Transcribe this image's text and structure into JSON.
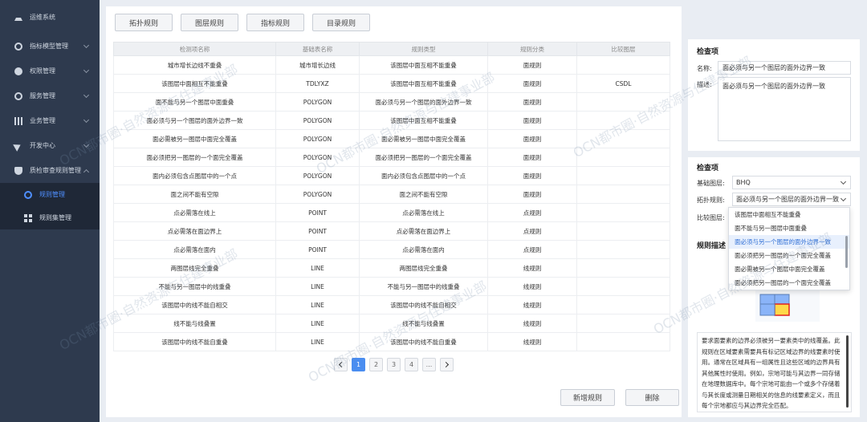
{
  "sidebar": {
    "brand": "运维系统",
    "items": [
      {
        "label": "指标模型管理"
      },
      {
        "label": "权限管理"
      },
      {
        "label": "服务管理"
      },
      {
        "label": "业务管理"
      },
      {
        "label": "开发中心"
      },
      {
        "label": "质检审查规则管理"
      }
    ],
    "subitems": [
      {
        "label": "规则管理"
      },
      {
        "label": "规则集管理"
      }
    ]
  },
  "toolbar": {
    "tabs": [
      {
        "label": "拓扑规则"
      },
      {
        "label": "图层规则"
      },
      {
        "label": "指标规则"
      },
      {
        "label": "目录规则"
      }
    ]
  },
  "table": {
    "headers": [
      "检测项名称",
      "基础表名称",
      "规则类型",
      "规则分类",
      "比较图层"
    ],
    "rows": [
      [
        "城市增长边线不重叠",
        "城市增长边线",
        "该图层中面互相不能重叠",
        "面规则",
        ""
      ],
      [
        "该图层中面相互不能重叠",
        "TDLYXZ",
        "该图层中面互相不能重叠",
        "面规则",
        "CSDL"
      ],
      [
        "面不能与另一个图层中面重叠",
        "POLYGON",
        "面必须与另一个图层的面外边界一致",
        "面规则",
        ""
      ],
      [
        "面必须与另一个图层的面外边界一致",
        "POLYGON",
        "该图层中面互相不能重叠",
        "面规则",
        ""
      ],
      [
        "面必需被另一图层中面完全覆盖",
        "POLYGON",
        "面必需被另一图层中面完全覆盖",
        "面规则",
        ""
      ],
      [
        "面必须把另一图层的一个面完全覆盖",
        "POLYGON",
        "面必须把另一图层的一个面完全覆盖",
        "面规则",
        ""
      ],
      [
        "面内必须包含点图层中的一个点",
        "POLYGON",
        "面内必须包含点图层中的一个点",
        "面规则",
        ""
      ],
      [
        "面之间不能有空隙",
        "POLYGON",
        "面之间不能有空隙",
        "面规则",
        ""
      ],
      [
        "点必需落在线上",
        "POINT",
        "点必需落在线上",
        "点规则",
        ""
      ],
      [
        "点必需落在面边界上",
        "POINT",
        "点必需落在面边界上",
        "点规则",
        ""
      ],
      [
        "点必需落在面内",
        "POINT",
        "点必需落在面内",
        "点规则",
        ""
      ],
      [
        "两图层线完全重叠",
        "LINE",
        "两图层线完全重叠",
        "线规则",
        ""
      ],
      [
        "不能与另一图层中的线重叠",
        "LINE",
        "不能与另一图层中的线重叠",
        "线规则",
        ""
      ],
      [
        "该图层中的线不能自相交",
        "LINE",
        "该图层中的线不能自相交",
        "线规则",
        ""
      ],
      [
        "线不能与线叠置",
        "LINE",
        "线不能与线叠置",
        "线规则",
        ""
      ],
      [
        "该图层中的线不能自重叠",
        "LINE",
        "该图层中的线不能自重叠",
        "线规则",
        ""
      ]
    ]
  },
  "pager": {
    "pages": [
      "1",
      "2",
      "3",
      "4",
      "..."
    ],
    "current": "1"
  },
  "actions": {
    "add_label": "新增规则",
    "delete_label": "删除"
  },
  "detail": {
    "title1": "检查项",
    "name_label": "名称:",
    "name_value": "面必须与另一个图层的面外边界一致",
    "desc_label": "描述:",
    "desc_value": "面必须与另一个图层的面外边界一致",
    "title2": "检查项",
    "base_layer_label": "基础图层:",
    "base_layer_value": "BHQ",
    "topo_rule_label": "拓扑规则:",
    "topo_rule_value": "面必须与另一个图层的面外边界一致",
    "compare_layer_label": "比较图层:",
    "rule_desc_title": "规则描述",
    "rule_desc_text": "要求面要素的边界必须被另一要素类中的线覆盖。此规则在区域要素需要具有标记区域边界的线要素时使用。通常在区域具有一组属性且这些区域的边界具有其他属性时使用。例如，宗地可能与其边界一同存储在地理数据库中。每个宗地可能由一个或多个存储着与其长度或测量日期相关的信息的线要素定义，而且每个宗地都应与其边界完全匹配。"
  },
  "dropdown": {
    "options": [
      "该图层中面相互不能重叠",
      "面不能与另一图层中面重叠",
      "面必须与另一个图层的面外边界一致",
      "面必须把另一图层的一个面完全覆盖",
      "面必需被另一个图层中面完全覆盖",
      "面必须把另一图层的一个面完全覆盖"
    ],
    "selected_index": 2
  },
  "watermark": "OCN都市圈·自然资源与住建事业部",
  "colors": {
    "sidebar_bg": "#2e3a4e",
    "accent": "#4a8df0",
    "page_bg": "#e9edf3"
  }
}
